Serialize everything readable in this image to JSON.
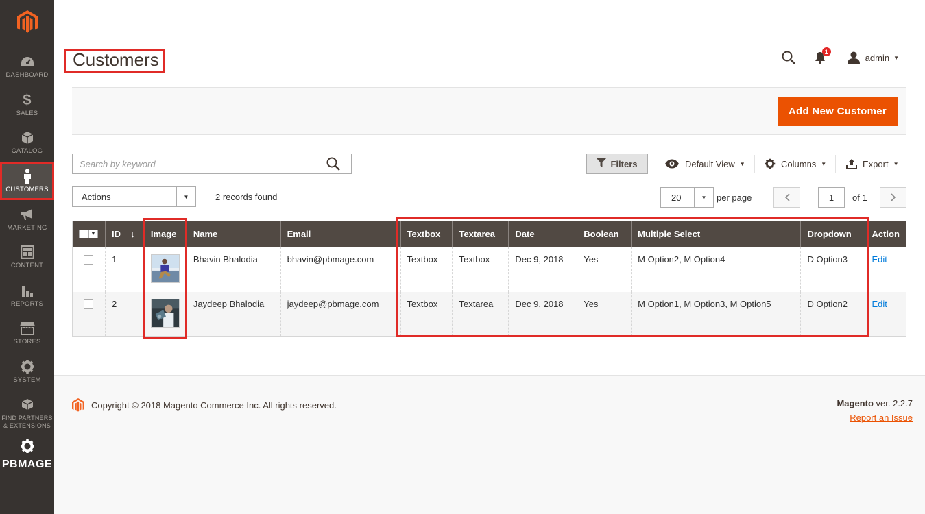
{
  "sidebar": {
    "items": [
      {
        "label": "DASHBOARD",
        "icon": "dashboard-icon"
      },
      {
        "label": "SALES",
        "icon": "dollar-icon"
      },
      {
        "label": "CATALOG",
        "icon": "cube-icon"
      },
      {
        "label": "CUSTOMERS",
        "icon": "person-icon",
        "active": true
      },
      {
        "label": "MARKETING",
        "icon": "megaphone-icon"
      },
      {
        "label": "CONTENT",
        "icon": "layout-icon"
      },
      {
        "label": "REPORTS",
        "icon": "bar-chart-icon"
      },
      {
        "label": "STORES",
        "icon": "store-icon"
      },
      {
        "label": "SYSTEM",
        "icon": "gear-icon"
      },
      {
        "label": "FIND PARTNERS",
        "label2": "& EXTENSIONS",
        "icon": "boxes-icon"
      }
    ],
    "brand": "PBMAGE"
  },
  "header": {
    "title": "Customers",
    "notification_count": "1",
    "user": "admin"
  },
  "actionbar": {
    "add_label": "Add New Customer"
  },
  "toolbar": {
    "search_placeholder": "Search by keyword",
    "filters_label": "Filters",
    "view_label": "Default View",
    "columns_label": "Columns",
    "export_label": "Export",
    "actions_label": "Actions",
    "records_found": "2 records found",
    "per_page_value": "20",
    "per_page_label": "per page",
    "page_value": "1",
    "page_of": "of 1"
  },
  "grid": {
    "columns": [
      "ID",
      "Image",
      "Name",
      "Email",
      "Textbox",
      "Textarea",
      "Date",
      "Boolean",
      "Multiple Select",
      "Dropdown",
      "Action"
    ],
    "rows": [
      {
        "id": "1",
        "name": "Bhavin Bhalodia",
        "email": "bhavin@pbmage.com",
        "textbox": "Textbox",
        "textarea": "Textbox",
        "date": "Dec 9, 2018",
        "boolean": "Yes",
        "multiselect": "M Option2, M Option4",
        "dropdown": "D Option3",
        "action": "Edit"
      },
      {
        "id": "2",
        "name": "Jaydeep Bhalodia",
        "email": "jaydeep@pbmage.com",
        "textbox": "Textbox",
        "textarea": "Textarea",
        "date": "Dec 9, 2018",
        "boolean": "Yes",
        "multiselect": "M Option1, M Option3, M Option5",
        "dropdown": "D Option2",
        "action": "Edit"
      }
    ]
  },
  "footer": {
    "copyright": "Copyright © 2018 Magento Commerce Inc. All rights reserved.",
    "brand": "Magento",
    "version": " ver. 2.2.7",
    "report_issue": "Report an Issue"
  },
  "colors": {
    "sidebar_bg": "#373330",
    "accent": "#eb5202",
    "highlight": "#e02b27",
    "grid_header": "#514943",
    "link": "#007bdb"
  }
}
